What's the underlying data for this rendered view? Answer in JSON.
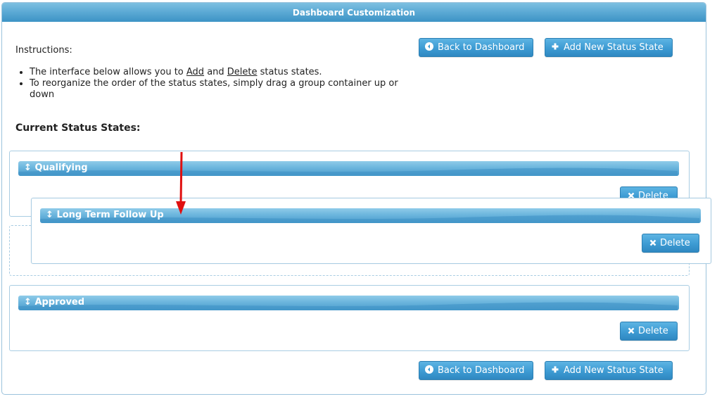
{
  "header": {
    "title": "Dashboard Customization"
  },
  "toolbar": {
    "back_label": "Back to Dashboard",
    "add_label": "Add New Status State"
  },
  "instructions": {
    "title": "Instructions:",
    "line1_pre": "The interface below allows you to ",
    "line1_add": "Add",
    "line1_mid": " and ",
    "line1_delete": "Delete",
    "line1_post": " status states.",
    "line2": "To reorganize the order of the status states, simply drag a group container up or down"
  },
  "current_title": "Current Status States:",
  "groups": [
    {
      "label": "Qualifying",
      "delete_label": "Delete"
    },
    {
      "label": "Long Term Follow Up",
      "delete_label": "Delete"
    },
    {
      "label": "Approved",
      "delete_label": "Delete"
    }
  ],
  "drag_symbol": "↕",
  "colors": {
    "accent": "#3d9bd3",
    "annotation_arrow": "#e01010"
  }
}
